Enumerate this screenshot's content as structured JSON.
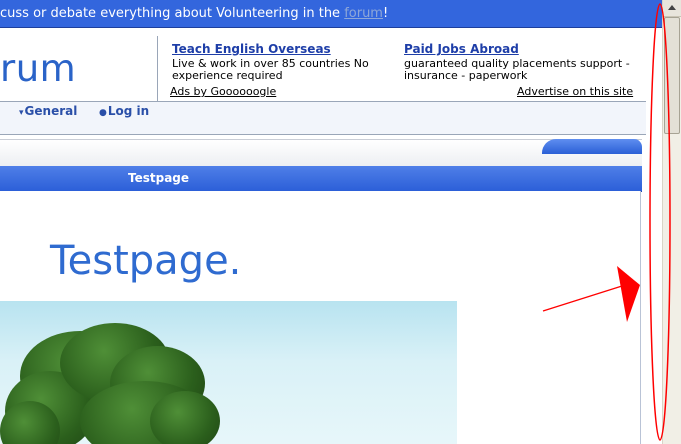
{
  "banner": {
    "text_before": "cuss or debate everything about Volunteering in the ",
    "link": "forum",
    "text_after": "!"
  },
  "logo": {
    "text": "rum"
  },
  "ads": [
    {
      "title": "Teach English Overseas",
      "desc": "Live & work in over 85 countries No experience required"
    },
    {
      "title": "Paid Jobs Abroad",
      "desc": "guaranteed quality placements support - insurance - paperwork"
    }
  ],
  "ads_by": "Ads by Goooooogle",
  "advertise": "Advertise on this site",
  "nav": {
    "items": [
      {
        "icon": "▾",
        "label": "General"
      },
      {
        "icon": "●",
        "label": "Log in"
      }
    ]
  },
  "titlebar": {
    "label": "Testpage"
  },
  "content": {
    "heading": "Testpage."
  },
  "colors": {
    "banner_bg": "#3366dd",
    "title_bar": "#2c5fd8",
    "annotation": "#ff0000"
  }
}
